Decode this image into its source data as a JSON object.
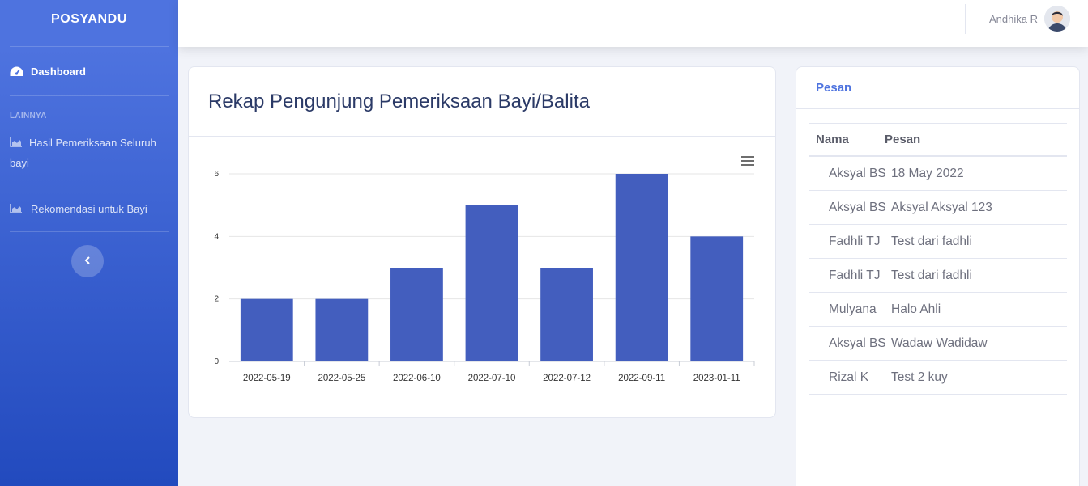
{
  "sidebar": {
    "brand": "POSYANDU",
    "dashboard": "Dashboard",
    "heading": "LAINNYA",
    "item_hasil": "Hasil Pemeriksaan Seluruh bayi",
    "item_rekomendasi": "Rekomendasi untuk Bayi",
    "toggle_icon": "chevron-left-icon"
  },
  "topbar": {
    "user_name": "Andhika R"
  },
  "chart_card": {
    "title": "Rekap Pengunjung Pemeriksaan Bayi/Balita"
  },
  "chart_data": {
    "type": "bar",
    "categories": [
      "2022-05-19",
      "2022-05-25",
      "2022-06-10",
      "2022-07-10",
      "2022-07-12",
      "2022-09-11",
      "2023-01-11"
    ],
    "values": [
      2,
      2,
      3,
      5,
      3,
      6,
      4
    ],
    "ylim": [
      0,
      6
    ],
    "yticks": [
      0,
      2,
      4,
      6
    ],
    "grid": true,
    "bar_color": "#435ebe"
  },
  "messages": {
    "title": "Pesan",
    "col_name": "Nama",
    "col_message": "Pesan",
    "rows": [
      {
        "name": "Aksyal BS",
        "message": "18 May 2022"
      },
      {
        "name": "Aksyal BS",
        "message": "Aksyal Aksyal 123"
      },
      {
        "name": "Fadhli TJ",
        "message": "Test dari fadhli"
      },
      {
        "name": "Fadhli TJ",
        "message": "Test dari fadhli"
      },
      {
        "name": "Mulyana",
        "message": "Halo Ahli"
      },
      {
        "name": "Aksyal BS",
        "message": "Wadaw Wadidaw"
      },
      {
        "name": "Rizal K",
        "message": "Test 2 kuy"
      }
    ]
  }
}
